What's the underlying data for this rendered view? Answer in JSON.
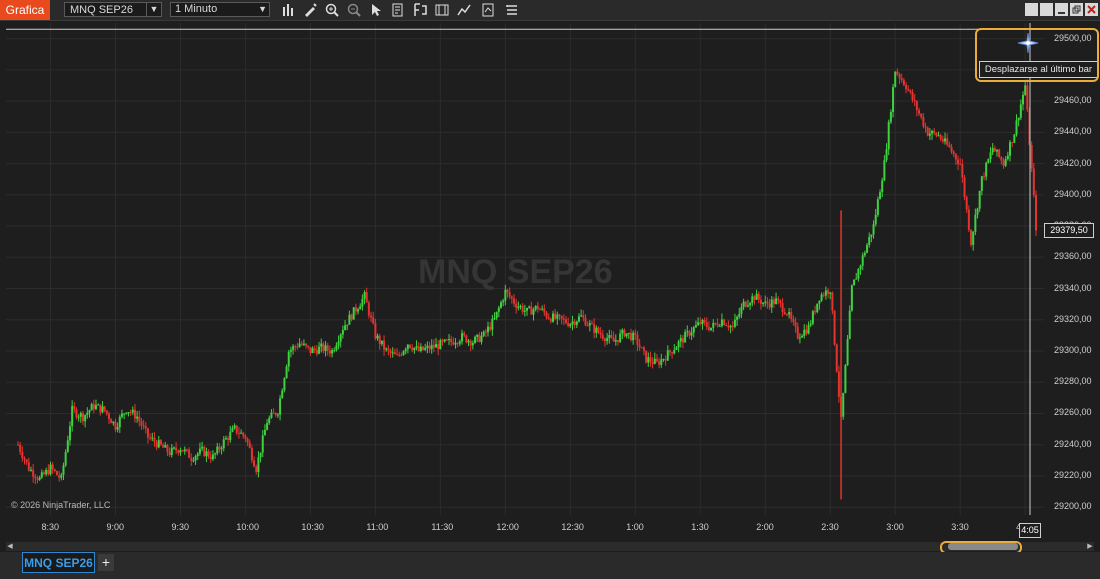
{
  "app": {
    "tab_label": "Grafica"
  },
  "toolbar": {
    "instrument": "MNQ SEP26",
    "interval": "1 Minuto",
    "tools": [
      "bar-chart-icon",
      "pencil-icon",
      "zoom-in-icon",
      "zoom-out-icon",
      "cursor-icon",
      "properties-icon",
      "template-icon",
      "strategy-icon",
      "indicator-icon",
      "chart-trader-icon",
      "more-menu-icon"
    ]
  },
  "window_controls": [
    "tile-icon",
    "tile-icon",
    "minimize-icon",
    "restore-icon",
    "close-icon"
  ],
  "chart": {
    "watermark": "MNQ SEP26",
    "copyright": "© 2026 NinjaTrader, LLC",
    "tooltip": "Desplazarse al último bar",
    "last_price_label": "29379,50",
    "time_marker_label": "4:05",
    "crosshair_price_level": 29506,
    "price_axis_labels": [
      "29500,00",
      "29480,00",
      "29460,00",
      "29440,00",
      "29420,00",
      "29400,00",
      "29380,00",
      "29360,00",
      "29340,00",
      "29320,00",
      "29300,00",
      "29280,00",
      "29260,00",
      "29240,00",
      "29220,00",
      "29200,00"
    ],
    "time_axis_labels": [
      "8:30",
      "9:00",
      "9:30",
      "10:00",
      "10:30",
      "11:00",
      "11:30",
      "12:00",
      "12:30",
      "1:00",
      "1:30",
      "2:00",
      "2:30",
      "3:00",
      "3:30",
      "4:"
    ],
    "colors": {
      "up": "#3fd13f",
      "down": "#e3342f",
      "grid": "#2c2c2c",
      "background": "#1e1e1e"
    }
  },
  "chart_data": {
    "type": "candlestick",
    "x_unit": "time",
    "y_range": [
      29195,
      29510
    ],
    "series": [
      {
        "points": [
          {
            "t": "8:15",
            "close": 29240
          },
          {
            "t": "8:20",
            "close": 29225
          },
          {
            "t": "8:25",
            "close": 29218
          },
          {
            "t": "8:30",
            "close": 29225
          },
          {
            "t": "8:35",
            "close": 29218
          },
          {
            "t": "8:40",
            "close": 29262
          },
          {
            "t": "8:45",
            "close": 29258
          },
          {
            "t": "8:50",
            "close": 29265
          },
          {
            "t": "8:55",
            "close": 29262
          },
          {
            "t": "9:00",
            "close": 29252
          },
          {
            "t": "9:05",
            "close": 29263
          },
          {
            "t": "9:10",
            "close": 29258
          },
          {
            "t": "9:15",
            "close": 29245
          },
          {
            "t": "9:20",
            "close": 29240
          },
          {
            "t": "9:25",
            "close": 29235
          },
          {
            "t": "9:30",
            "close": 29238
          },
          {
            "t": "9:35",
            "close": 29232
          },
          {
            "t": "9:40",
            "close": 29236
          },
          {
            "t": "9:45",
            "close": 29232
          },
          {
            "t": "9:50",
            "close": 29242
          },
          {
            "t": "9:55",
            "close": 29250
          },
          {
            "t": "10:00",
            "close": 29245
          },
          {
            "t": "10:05",
            "close": 29225
          },
          {
            "t": "10:10",
            "close": 29255
          },
          {
            "t": "10:15",
            "close": 29262
          },
          {
            "t": "10:20",
            "close": 29300
          },
          {
            "t": "10:25",
            "close": 29305
          },
          {
            "t": "10:30",
            "close": 29300
          },
          {
            "t": "10:35",
            "close": 29302
          },
          {
            "t": "10:40",
            "close": 29300
          },
          {
            "t": "10:45",
            "close": 29315
          },
          {
            "t": "10:50",
            "close": 29325
          },
          {
            "t": "10:55",
            "close": 29335
          },
          {
            "t": "11:00",
            "close": 29310
          },
          {
            "t": "11:05",
            "close": 29300
          },
          {
            "t": "11:10",
            "close": 29296
          },
          {
            "t": "11:15",
            "close": 29305
          },
          {
            "t": "11:20",
            "close": 29300
          },
          {
            "t": "11:25",
            "close": 29302
          },
          {
            "t": "11:30",
            "close": 29304
          },
          {
            "t": "11:35",
            "close": 29306
          },
          {
            "t": "11:40",
            "close": 29309
          },
          {
            "t": "11:45",
            "close": 29306
          },
          {
            "t": "11:50",
            "close": 29310
          },
          {
            "t": "11:55",
            "close": 29320
          },
          {
            "t": "12:00",
            "close": 29338
          },
          {
            "t": "12:05",
            "close": 29330
          },
          {
            "t": "12:10",
            "close": 29325
          },
          {
            "t": "12:15",
            "close": 29328
          },
          {
            "t": "12:20",
            "close": 29322
          },
          {
            "t": "12:25",
            "close": 29320
          },
          {
            "t": "12:30",
            "close": 29318
          },
          {
            "t": "12:35",
            "close": 29322
          },
          {
            "t": "12:40",
            "close": 29315
          },
          {
            "t": "12:45",
            "close": 29310
          },
          {
            "t": "12:50",
            "close": 29306
          },
          {
            "t": "12:55",
            "close": 29312
          },
          {
            "t": "1:00",
            "close": 29308
          },
          {
            "t": "1:05",
            "close": 29295
          },
          {
            "t": "1:10",
            "close": 29292
          },
          {
            "t": "1:15",
            "close": 29298
          },
          {
            "t": "1:20",
            "close": 29305
          },
          {
            "t": "1:25",
            "close": 29312
          },
          {
            "t": "1:30",
            "close": 29318
          },
          {
            "t": "1:35",
            "close": 29315
          },
          {
            "t": "1:40",
            "close": 29320
          },
          {
            "t": "1:45",
            "close": 29315
          },
          {
            "t": "1:50",
            "close": 29330
          },
          {
            "t": "1:55",
            "close": 29335
          },
          {
            "t": "2:00",
            "close": 29330
          },
          {
            "t": "2:05",
            "close": 29332
          },
          {
            "t": "2:10",
            "close": 29325
          },
          {
            "t": "2:15",
            "close": 29310
          },
          {
            "t": "2:20",
            "close": 29315
          },
          {
            "t": "2:25",
            "close": 29335
          },
          {
            "t": "2:30",
            "close": 29340
          },
          {
            "t": "2:35",
            "close": 29255
          },
          {
            "t": "2:40",
            "close": 29340
          },
          {
            "t": "2:45",
            "close": 29360
          },
          {
            "t": "2:50",
            "close": 29380
          },
          {
            "t": "2:55",
            "close": 29420
          },
          {
            "t": "3:00",
            "close": 29480
          },
          {
            "t": "3:05",
            "close": 29470
          },
          {
            "t": "3:10",
            "close": 29455
          },
          {
            "t": "3:15",
            "close": 29440
          },
          {
            "t": "3:20",
            "close": 29438
          },
          {
            "t": "3:25",
            "close": 29430
          },
          {
            "t": "3:30",
            "close": 29420
          },
          {
            "t": "3:35",
            "close": 29370
          },
          {
            "t": "3:40",
            "close": 29410
          },
          {
            "t": "3:45",
            "close": 29430
          },
          {
            "t": "3:50",
            "close": 29420
          },
          {
            "t": "3:55",
            "close": 29440
          },
          {
            "t": "4:00",
            "close": 29470
          },
          {
            "t": "4:05",
            "close": 29379.5
          }
        ]
      }
    ]
  }
}
